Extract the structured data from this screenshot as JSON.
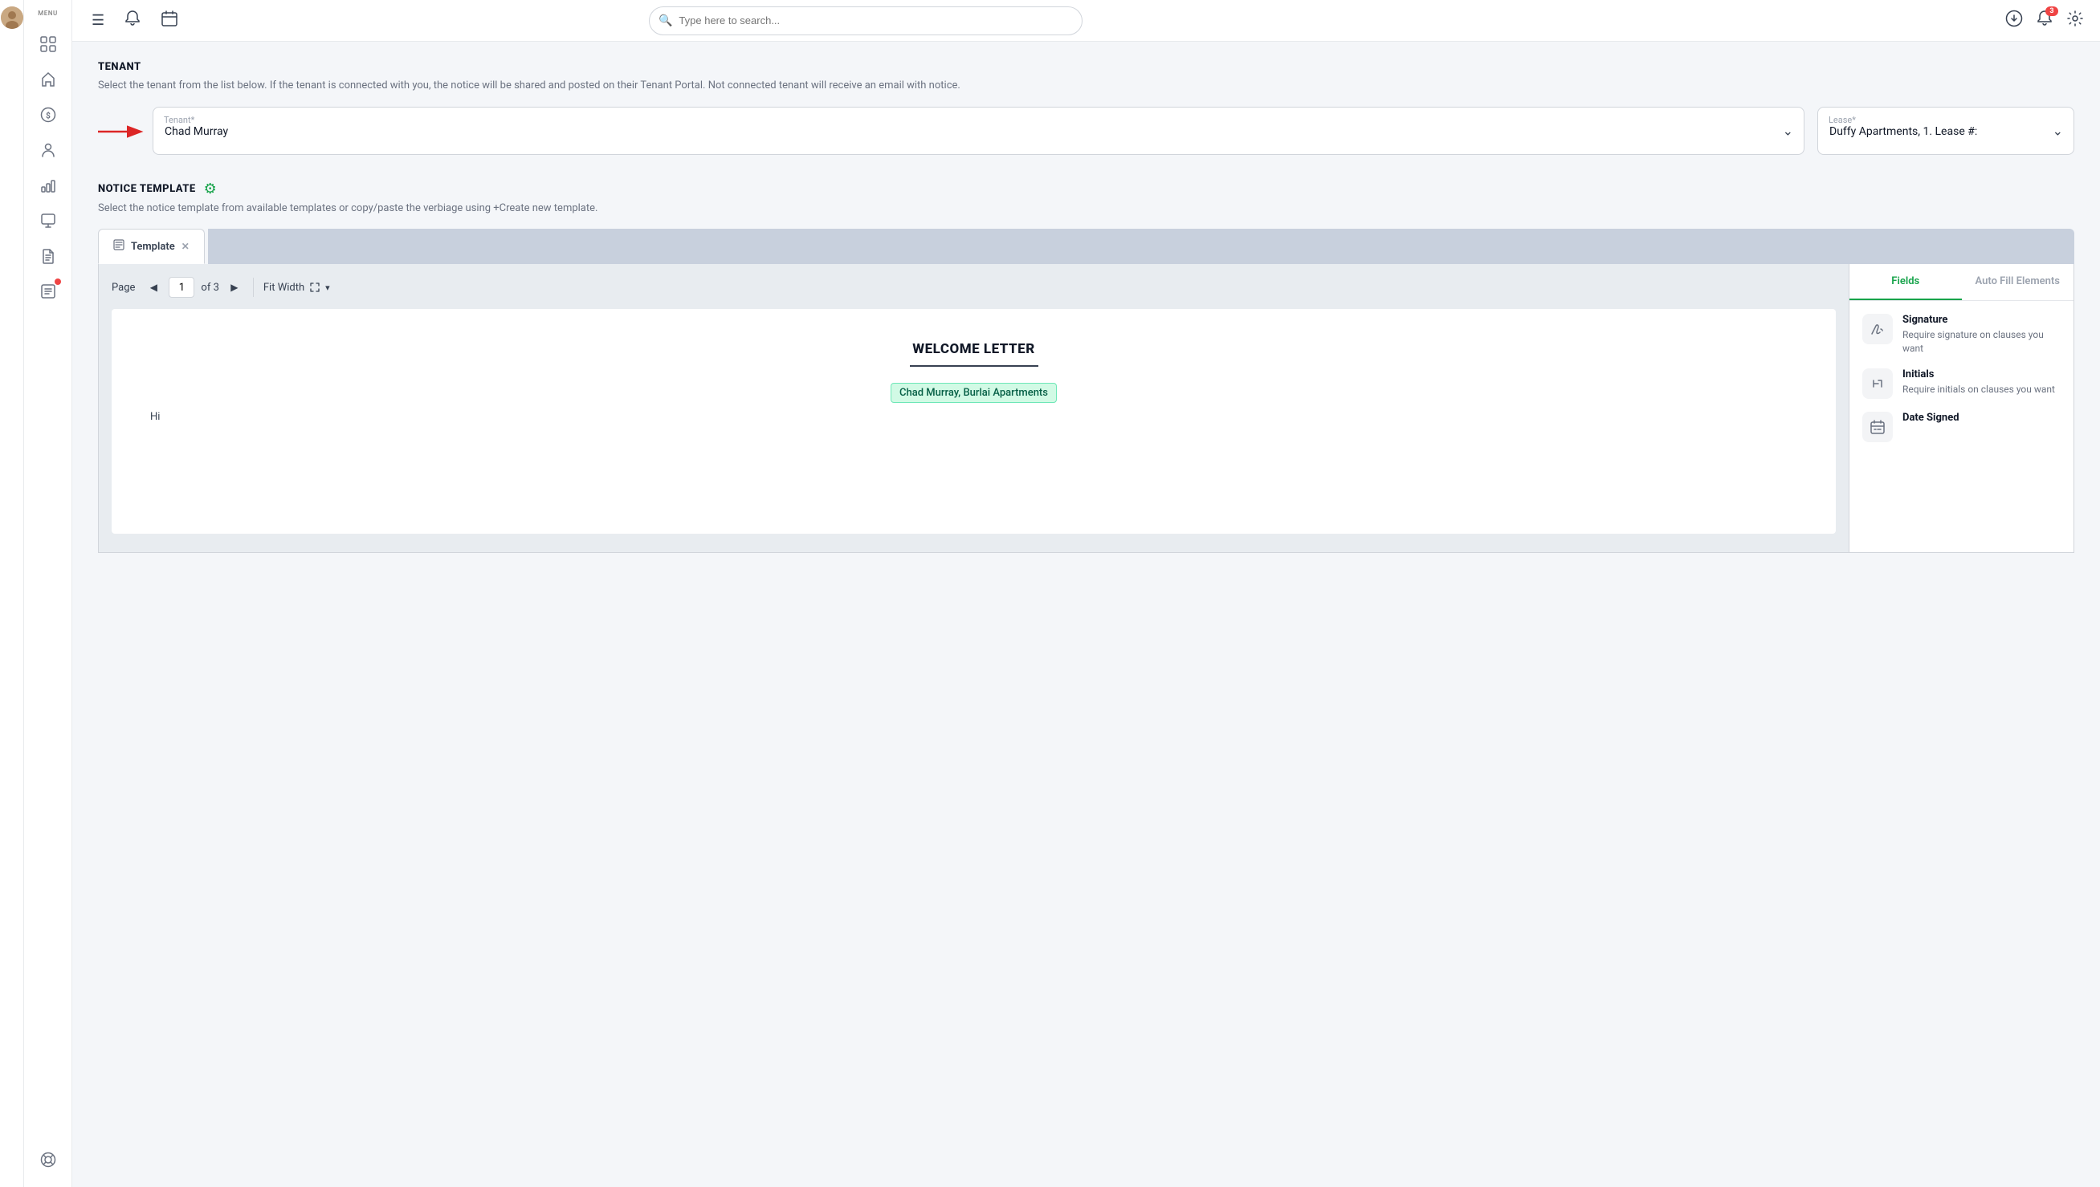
{
  "topnav": {
    "search_placeholder": "Type here to search...",
    "notification_count": "3"
  },
  "sidebar": {
    "menu_label": "MENU",
    "items": [
      {
        "id": "dashboard",
        "icon": "⊞"
      },
      {
        "id": "home",
        "icon": "⌂"
      },
      {
        "id": "dollar",
        "icon": "$"
      },
      {
        "id": "person",
        "icon": "👤"
      },
      {
        "id": "chart",
        "icon": "📊"
      },
      {
        "id": "design",
        "icon": "🖥"
      },
      {
        "id": "document",
        "icon": "📄"
      },
      {
        "id": "report-badge",
        "icon": "📋",
        "has_badge": true
      },
      {
        "id": "support",
        "icon": "💬"
      }
    ]
  },
  "tenant_section": {
    "title": "TENANT",
    "description": "Select the tenant from the list below. If the tenant is connected with you, the notice will be shared and posted on their Tenant Portal. Not connected tenant will receive an email with notice.",
    "tenant_label": "Tenant*",
    "tenant_value": "Chad Murray",
    "lease_label": "Lease*",
    "lease_value": "Duffy Apartments, 1. Lease #:"
  },
  "notice_template_section": {
    "title": "NOTICE TEMPLATE",
    "description": "Select the notice template from available templates or copy/paste the verbiage using +Create new template.",
    "tab_label": "Template",
    "page_label": "Page",
    "page_current": "1",
    "page_total": "of 3",
    "fit_width_label": "Fit Width",
    "doc_title": "WELCOME LETTER",
    "doc_highlight_text": "Chad Murray, Burlai Apartments",
    "doc_hi": "Hi"
  },
  "fields_panel": {
    "tab_fields": "Fields",
    "tab_autofill": "Auto Fill Elements",
    "items": [
      {
        "id": "signature",
        "name": "Signature",
        "description": "Require signature on clauses you want",
        "icon": "✒"
      },
      {
        "id": "initials",
        "name": "Initials",
        "description": "Require initials on clauses you want",
        "icon": "✏"
      },
      {
        "id": "date-signed",
        "name": "Date Signed",
        "description": "",
        "icon": "📅"
      }
    ]
  }
}
